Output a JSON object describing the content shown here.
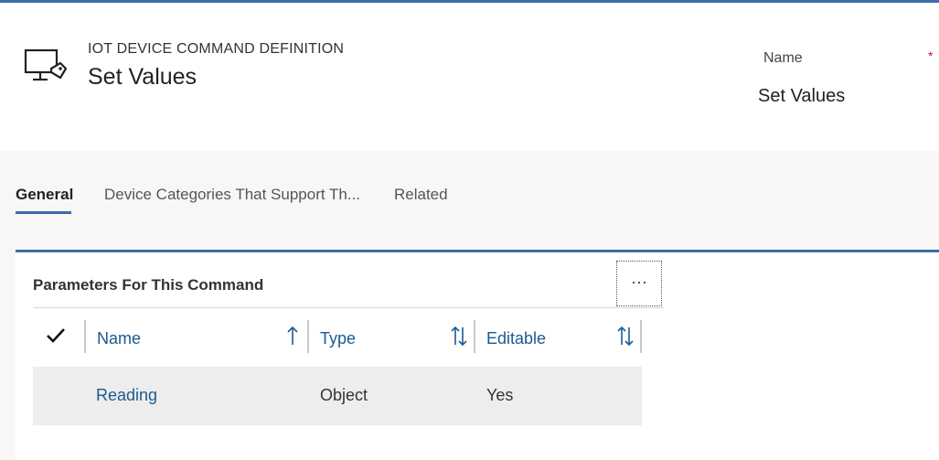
{
  "header": {
    "entity_type": "IOT DEVICE COMMAND DEFINITION",
    "record_title": "Set Values",
    "name_field": {
      "label": "Name",
      "required_marker": "*",
      "value": "Set Values"
    },
    "entity_icon": "device-command-icon"
  },
  "tabs": [
    {
      "label": "General",
      "active": true
    },
    {
      "label": "Device Categories That Support Th...",
      "active": false
    },
    {
      "label": "Related",
      "active": false
    }
  ],
  "grid": {
    "title": "Parameters For This Command",
    "more_label": "···",
    "columns": [
      {
        "label": "Name",
        "sort_icon": "sort-ascending-icon"
      },
      {
        "label": "Type",
        "sort_icon": "sort-both-icon"
      },
      {
        "label": "Editable",
        "sort_icon": "sort-both-icon"
      }
    ],
    "rows": [
      {
        "name": "Reading",
        "type": "Object",
        "editable": "Yes"
      }
    ]
  },
  "colors": {
    "accent": "#3a6ea8",
    "link": "#1c5a8f",
    "required": "#c8102e",
    "row_bg": "#ededed"
  }
}
